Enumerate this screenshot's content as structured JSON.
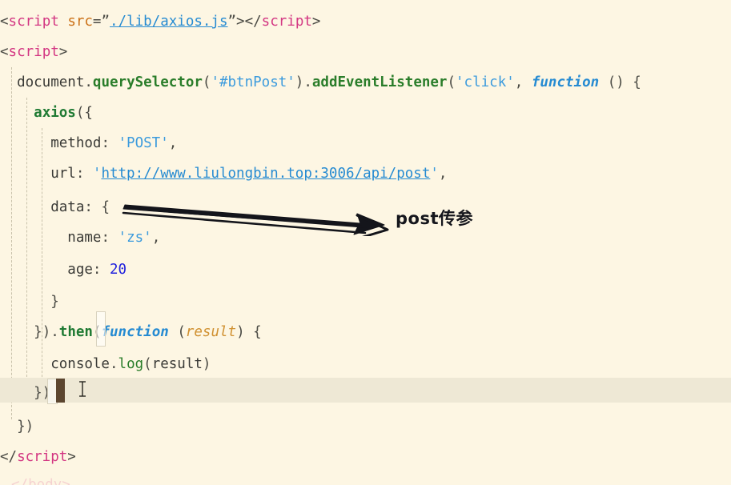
{
  "editor": {
    "name": "code-editor",
    "language": "html",
    "theme": "solarized-light",
    "background_color": "#fdf6e3",
    "active_line_color": "#eee8d5",
    "caret_color": "#5c4630",
    "indent_guide_color": "#c9c2ab"
  },
  "lines": [
    {
      "n": 1,
      "indent": 0,
      "tokens": [
        {
          "t": "<",
          "c": "tok-punc"
        },
        {
          "t": "script",
          "c": "tok-tag"
        },
        {
          "t": " ",
          "c": "tok-plain"
        },
        {
          "t": "src",
          "c": "tok-attr"
        },
        {
          "t": "=”",
          "c": "tok-punc"
        },
        {
          "t": "./lib/axios.js",
          "c": "tok-link"
        },
        {
          "t": "”>",
          "c": "tok-punc"
        },
        {
          "t": "</",
          "c": "tok-punc"
        },
        {
          "t": "script",
          "c": "tok-tag"
        },
        {
          "t": ">",
          "c": "tok-punc"
        }
      ]
    },
    {
      "n": 2,
      "indent": 0,
      "tokens": [
        {
          "t": "<",
          "c": "tok-punc"
        },
        {
          "t": "script",
          "c": "tok-tag"
        },
        {
          "t": ">",
          "c": "tok-punc"
        }
      ]
    },
    {
      "n": 3,
      "indent": 2,
      "tokens": [
        {
          "t": "document",
          "c": "tok-plain"
        },
        {
          "t": ".",
          "c": "tok-punc"
        },
        {
          "t": "querySelector",
          "c": "tok-method"
        },
        {
          "t": "(",
          "c": "tok-punc"
        },
        {
          "t": "'#btnPost'",
          "c": "tok-str"
        },
        {
          "t": ")",
          "c": "tok-punc"
        },
        {
          "t": ".",
          "c": "tok-punc"
        },
        {
          "t": "addEventListener",
          "c": "tok-method"
        },
        {
          "t": "(",
          "c": "tok-punc"
        },
        {
          "t": "'click'",
          "c": "tok-str"
        },
        {
          "t": ", ",
          "c": "tok-punc"
        },
        {
          "t": "function",
          "c": "tok-kw"
        },
        {
          "t": " () {",
          "c": "tok-punc"
        }
      ]
    },
    {
      "n": 4,
      "indent": 4,
      "tokens": [
        {
          "t": "axios",
          "c": "tok-bold-green"
        },
        {
          "t": "({",
          "c": "tok-punc"
        }
      ]
    },
    {
      "n": 5,
      "indent": 6,
      "tokens": [
        {
          "t": "method",
          "c": "tok-plain"
        },
        {
          "t": ": ",
          "c": "tok-punc"
        },
        {
          "t": "'POST'",
          "c": "tok-str"
        },
        {
          "t": ",",
          "c": "tok-punc"
        }
      ]
    },
    {
      "n": 6,
      "indent": 6,
      "tokens": [
        {
          "t": "url",
          "c": "tok-plain"
        },
        {
          "t": ": ",
          "c": "tok-punc"
        },
        {
          "t": "'",
          "c": "tok-str"
        },
        {
          "t": "http://www.liulongbin.top:3006/api/post",
          "c": "tok-link"
        },
        {
          "t": "'",
          "c": "tok-str"
        },
        {
          "t": ",",
          "c": "tok-punc"
        }
      ]
    },
    {
      "n": 7,
      "indent": 6,
      "tokens": [
        {
          "t": "data",
          "c": "tok-plain"
        },
        {
          "t": ": {",
          "c": "tok-punc"
        }
      ]
    },
    {
      "n": 8,
      "indent": 8,
      "tokens": [
        {
          "t": "name",
          "c": "tok-plain"
        },
        {
          "t": ": ",
          "c": "tok-punc"
        },
        {
          "t": "'zs'",
          "c": "tok-str"
        },
        {
          "t": ",",
          "c": "tok-punc"
        }
      ]
    },
    {
      "n": 9,
      "indent": 8,
      "tokens": [
        {
          "t": "age",
          "c": "tok-plain"
        },
        {
          "t": ": ",
          "c": "tok-punc"
        },
        {
          "t": "20",
          "c": "tok-num"
        }
      ]
    },
    {
      "n": 10,
      "indent": 6,
      "tokens": [
        {
          "t": "}",
          "c": "tok-punc"
        }
      ]
    },
    {
      "n": 11,
      "indent": 4,
      "tokens": [
        {
          "t": "})",
          "c": "tok-punc"
        },
        {
          "t": ".",
          "c": "tok-punc"
        },
        {
          "t": "then",
          "c": "tok-bold-green"
        },
        {
          "t": "(",
          "c": "tok-punc"
        },
        {
          "t": "function",
          "c": "tok-kw"
        },
        {
          "t": " (",
          "c": "tok-punc"
        },
        {
          "t": "result",
          "c": "tok-param"
        },
        {
          "t": ") {",
          "c": "tok-punc"
        }
      ]
    },
    {
      "n": 12,
      "indent": 6,
      "tokens": [
        {
          "t": "console",
          "c": "tok-plain"
        },
        {
          "t": ".",
          "c": "tok-punc"
        },
        {
          "t": "log",
          "c": "tok-green"
        },
        {
          "t": "(",
          "c": "tok-punc"
        },
        {
          "t": "result",
          "c": "tok-plain"
        },
        {
          "t": ")",
          "c": "tok-punc"
        }
      ]
    },
    {
      "n": 13,
      "indent": 4,
      "tokens": [
        {
          "t": "})",
          "c": "tok-punc"
        }
      ]
    },
    {
      "n": 14,
      "indent": 2,
      "tokens": [
        {
          "t": "})",
          "c": "tok-punc"
        }
      ]
    },
    {
      "n": 15,
      "indent": 0,
      "tokens": [
        {
          "t": "</",
          "c": "tok-punc"
        },
        {
          "t": "script",
          "c": "tok-tag"
        },
        {
          "t": ">",
          "c": "tok-punc"
        }
      ]
    }
  ],
  "annotation": {
    "label": "post传参",
    "arrow_name": "hand-drawn-arrow",
    "color": "#15161c"
  },
  "caret": {
    "line": 13,
    "visible": true
  },
  "mouse": {
    "shape": "text-ibeam"
  },
  "clipped_bottom_line": "</body>"
}
